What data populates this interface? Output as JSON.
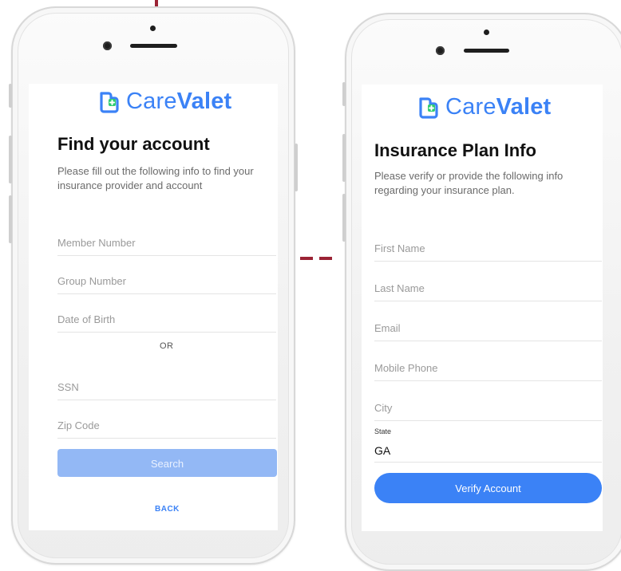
{
  "brand": {
    "care": "Care",
    "valet": "Valet",
    "logo_icon": "carevalet-plus-icon",
    "color": "#3b82f6"
  },
  "connector_color": "#9b2335",
  "find_account": {
    "title": "Find your account",
    "subtitle": "Please fill out the following info to find your insurance provider and account",
    "fields": {
      "member_number": "Member Number",
      "group_number": "Group Number",
      "date_of_birth": "Date of Birth",
      "ssn": "SSN",
      "zip_code": "Zip Code"
    },
    "or_label": "OR",
    "search_label": "Search",
    "back_label": "BACK"
  },
  "insurance_plan": {
    "title": "Insurance Plan Info",
    "subtitle": "Please verify or provide the following info regarding your insurance plan.",
    "fields": {
      "first_name": "First Name",
      "last_name": "Last Name",
      "email": "Email",
      "mobile_phone": "Mobile Phone",
      "city": "City",
      "state_label": "State",
      "state_value": "GA"
    },
    "verify_label": "Verify Account"
  }
}
